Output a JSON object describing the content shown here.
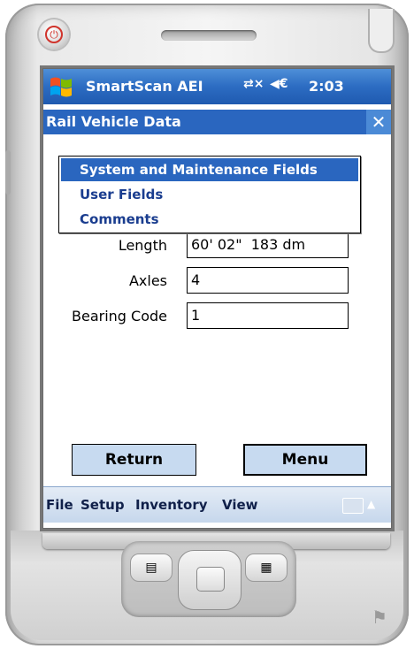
{
  "status": {
    "app_title": "SmartScan AEI",
    "connectivity_icon": "⇄×",
    "volume_icon": "◀€",
    "time": "2:03"
  },
  "header": {
    "title": "Rail Vehicle Data",
    "close_glyph": "✕"
  },
  "dropdown": {
    "items": [
      {
        "label": "System and Maintenance Fields",
        "selected": true
      },
      {
        "label": "User Fields",
        "selected": false
      },
      {
        "label": "Comments",
        "selected": false
      }
    ]
  },
  "fields": [
    {
      "label": "Length",
      "value": "60' 02\"  183 dm"
    },
    {
      "label": "Axles",
      "value": "4"
    },
    {
      "label": "Bearing Code",
      "value": "1"
    }
  ],
  "buttons": {
    "return_label": "Return",
    "menu_label": "Menu"
  },
  "menubar": {
    "items": [
      "File",
      "Setup",
      "Inventory",
      "View"
    ]
  },
  "colors": {
    "titlebar": "#2c6cc2",
    "selection": "#2a66bf",
    "button_fill": "#c7daf0"
  }
}
